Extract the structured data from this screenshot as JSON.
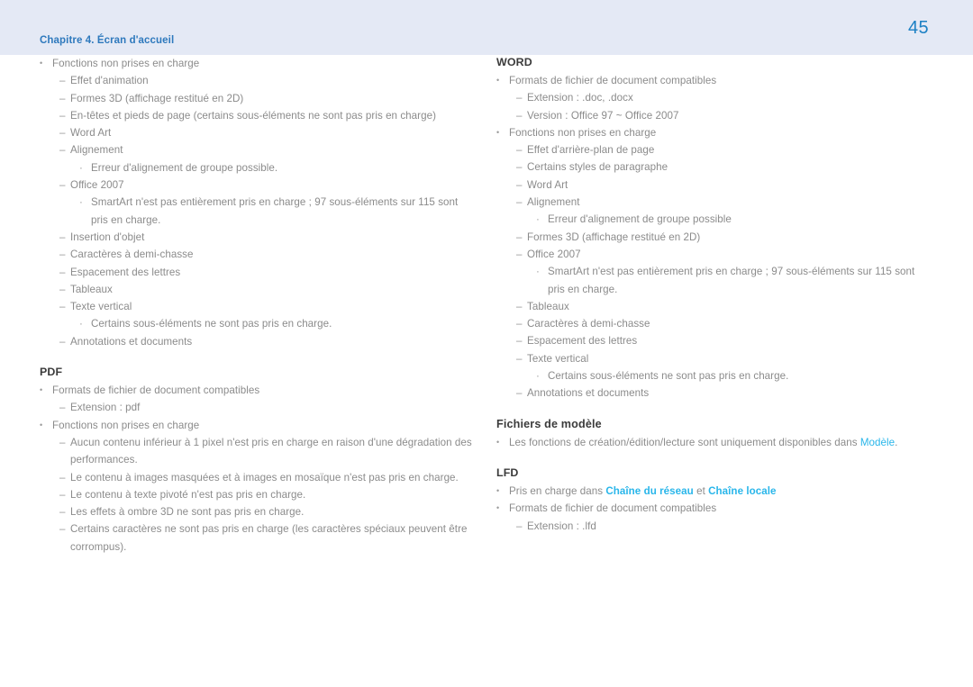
{
  "header": {
    "chapter_label": "Chapitre 4. Écran d'accueil",
    "page_number": "45",
    "band_color": "#e4e9f5",
    "chapter_color": "#2e79bd",
    "page_number_color": "#1b80c4"
  },
  "theme": {
    "body_text_color": "#8b8b8b",
    "heading_color": "#3b3b3b",
    "link_color": "#29b6ea",
    "page_background": "#ffffff"
  },
  "markers": {
    "level1": "•",
    "level2": "–",
    "level3": "·"
  },
  "left_column": {
    "blocks": [
      {
        "heading": null,
        "items": [
          {
            "level": 1,
            "text": "Fonctions non prises en charge"
          },
          {
            "level": 2,
            "text": "Effet d'animation"
          },
          {
            "level": 2,
            "text": "Formes 3D (affichage restitué en 2D)"
          },
          {
            "level": 2,
            "text": "En-têtes et pieds de page (certains sous-éléments ne sont pas pris en charge)"
          },
          {
            "level": 2,
            "text": "Word Art"
          },
          {
            "level": 2,
            "text": "Alignement"
          },
          {
            "level": 3,
            "text": "Erreur d'alignement de groupe possible."
          },
          {
            "level": 2,
            "text": "Office 2007"
          },
          {
            "level": 3,
            "text": "SmartArt n'est pas entièrement pris en charge ; 97 sous-éléments sur 115 sont pris en charge."
          },
          {
            "level": 2,
            "text": "Insertion d'objet"
          },
          {
            "level": 2,
            "text": "Caractères à demi-chasse"
          },
          {
            "level": 2,
            "text": "Espacement des lettres"
          },
          {
            "level": 2,
            "text": "Tableaux"
          },
          {
            "level": 2,
            "text": "Texte vertical"
          },
          {
            "level": 3,
            "text": "Certains sous-éléments ne sont pas pris en charge."
          },
          {
            "level": 2,
            "text": "Annotations et documents"
          }
        ]
      },
      {
        "heading": "PDF",
        "items": [
          {
            "level": 1,
            "text": "Formats de fichier de document compatibles"
          },
          {
            "level": 2,
            "text": "Extension : pdf"
          },
          {
            "level": 1,
            "text": "Fonctions non prises en charge"
          },
          {
            "level": 2,
            "text": "Aucun contenu inférieur à 1 pixel n'est pris en charge en raison d'une dégradation des performances."
          },
          {
            "level": 2,
            "text": "Le contenu à images masquées et à images en mosaïque n'est pas pris en charge."
          },
          {
            "level": 2,
            "text": "Le contenu à texte pivoté n'est pas pris en charge."
          },
          {
            "level": 2,
            "text": "Les effets à ombre 3D ne sont pas pris en charge."
          },
          {
            "level": 2,
            "text": "Certains caractères ne sont pas pris en charge (les caractères spéciaux peuvent être corrompus)."
          }
        ]
      }
    ]
  },
  "right_column": {
    "blocks": [
      {
        "heading": "WORD",
        "items": [
          {
            "level": 1,
            "text": "Formats de fichier de document compatibles"
          },
          {
            "level": 2,
            "text": "Extension : .doc, .docx"
          },
          {
            "level": 2,
            "text": "Version : Office 97 ~ Office 2007"
          },
          {
            "level": 1,
            "text": "Fonctions non prises en charge"
          },
          {
            "level": 2,
            "text": "Effet d'arrière-plan de page"
          },
          {
            "level": 2,
            "text": "Certains styles de paragraphe"
          },
          {
            "level": 2,
            "text": "Word Art"
          },
          {
            "level": 2,
            "text": "Alignement"
          },
          {
            "level": 3,
            "text": "Erreur d'alignement de groupe possible"
          },
          {
            "level": 2,
            "text": "Formes 3D (affichage restitué en 2D)"
          },
          {
            "level": 2,
            "text": "Office 2007"
          },
          {
            "level": 3,
            "text": "SmartArt n'est pas entièrement pris en charge ; 97 sous-éléments sur 115 sont pris en charge."
          },
          {
            "level": 2,
            "text": "Tableaux"
          },
          {
            "level": 2,
            "text": "Caractères à demi-chasse"
          },
          {
            "level": 2,
            "text": "Espacement des lettres"
          },
          {
            "level": 2,
            "text": "Texte vertical"
          },
          {
            "level": 3,
            "text": "Certains sous-éléments ne sont pas pris en charge."
          },
          {
            "level": 2,
            "text": "Annotations et documents"
          }
        ]
      },
      {
        "heading": "Fichiers de modèle",
        "heading_style": "sub",
        "items": [
          {
            "level": 1,
            "parts": [
              {
                "type": "text",
                "text": "Les fonctions de création/édition/lecture sont uniquement disponibles dans "
              },
              {
                "type": "link",
                "text": "Modèle",
                "bold": false
              },
              {
                "type": "text",
                "text": "."
              }
            ]
          }
        ]
      },
      {
        "heading": "LFD",
        "items": [
          {
            "level": 1,
            "parts": [
              {
                "type": "text",
                "text": "Pris en charge dans "
              },
              {
                "type": "link",
                "text": "Chaîne du réseau",
                "bold": true
              },
              {
                "type": "text",
                "text": " et "
              },
              {
                "type": "link",
                "text": "Chaîne locale",
                "bold": true
              }
            ]
          },
          {
            "level": 1,
            "text": "Formats de fichier de document compatibles"
          },
          {
            "level": 2,
            "text": "Extension : .lfd"
          }
        ]
      }
    ]
  }
}
